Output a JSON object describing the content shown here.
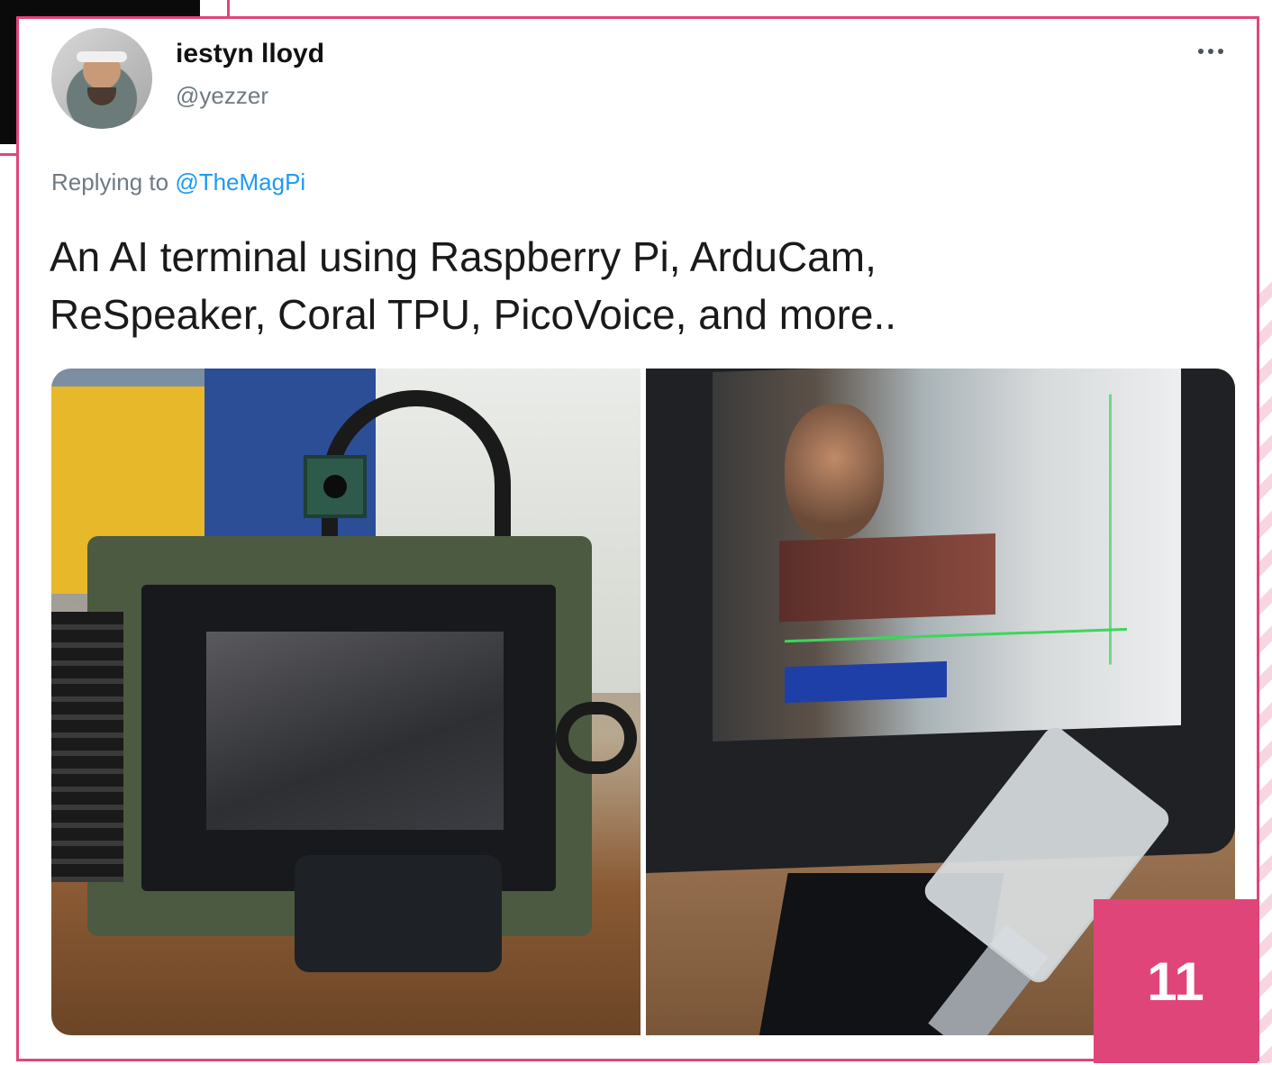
{
  "tweet": {
    "author_name": "iestyn lloyd",
    "author_handle": "@yezzer",
    "replying_to_prefix": "Replying to",
    "replying_to_handle": "@TheMagPi",
    "text_line_1": "An AI terminal using Raspberry Pi, ArduCam,",
    "text_line_2": "ReSpeaker, Coral TPU, PicoVoice, and more..",
    "more_icon": "more-horizontal-icon",
    "media_count": 2
  },
  "page_number": "11",
  "colors": {
    "accent": "#e0457a",
    "link": "#1d9bf0",
    "text": "#1a1a1a",
    "muted": "#6f7a82"
  }
}
